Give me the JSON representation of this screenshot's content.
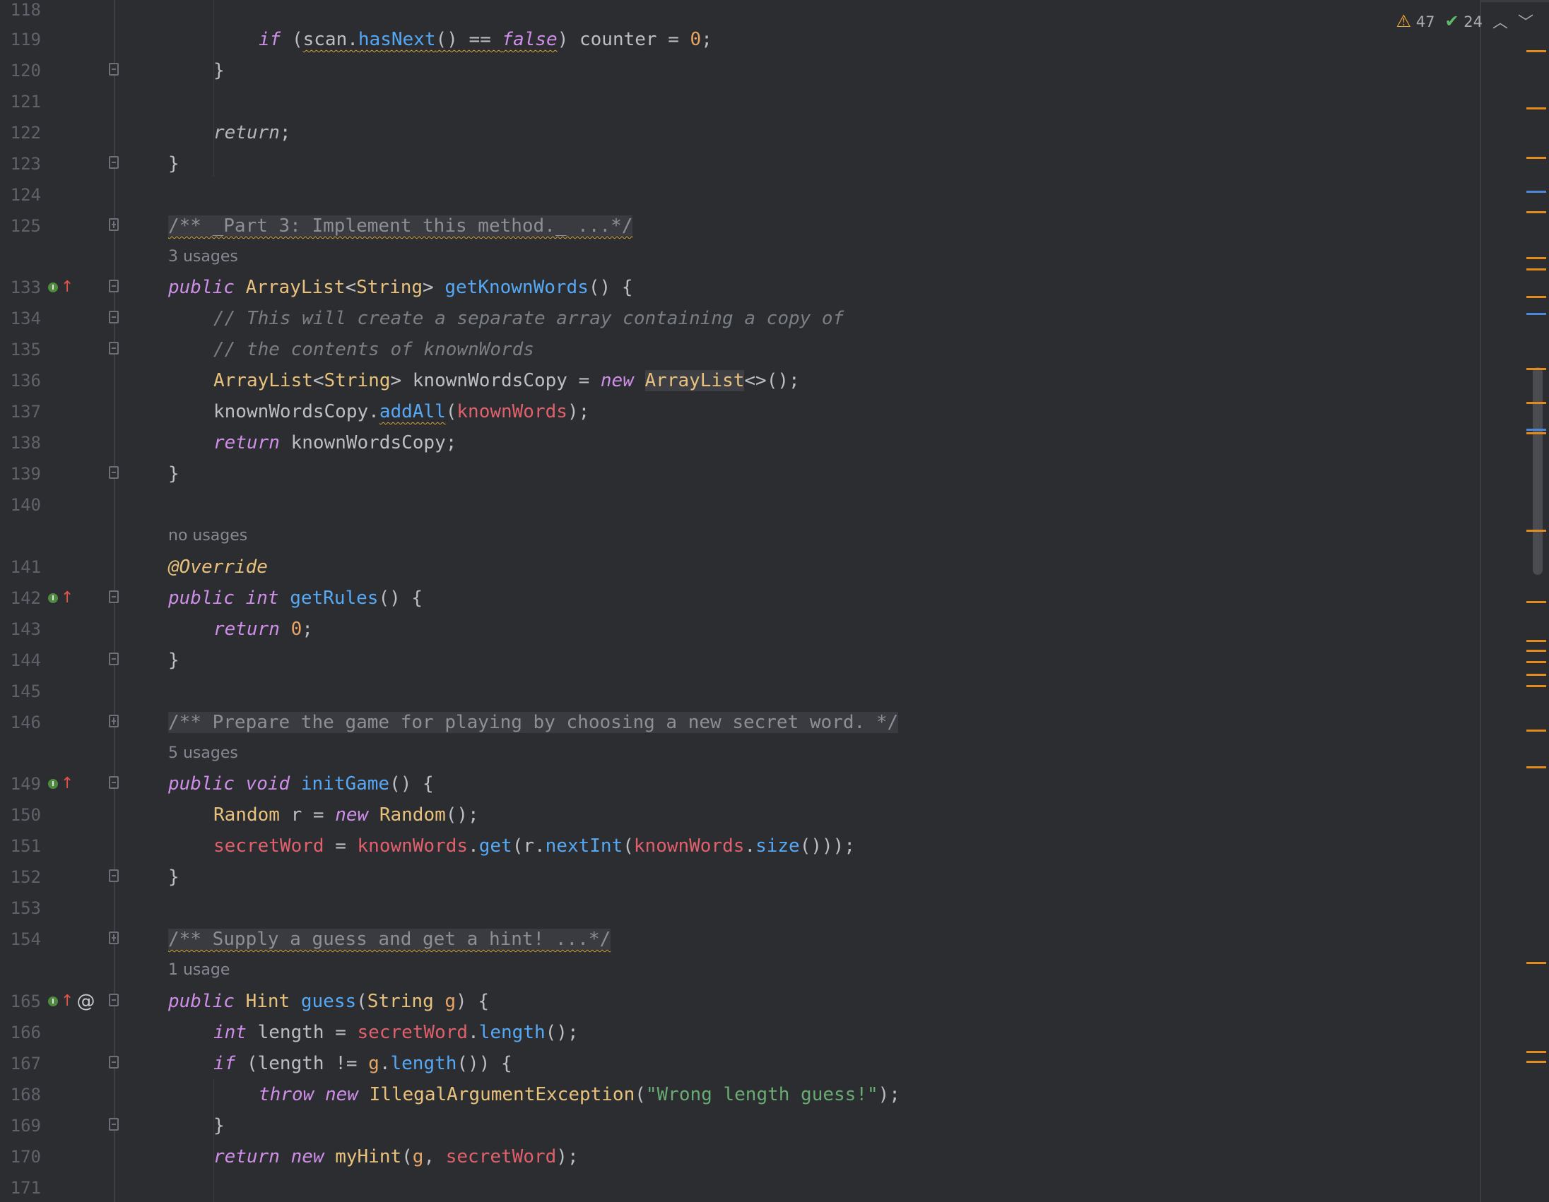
{
  "inspections": {
    "warnings": "47",
    "weak_warnings": "24"
  },
  "gutter_lines": [
    {
      "n": "118"
    },
    {
      "n": "119"
    },
    {
      "n": "120"
    },
    {
      "n": "121"
    },
    {
      "n": "122"
    },
    {
      "n": "123"
    },
    {
      "n": "124"
    },
    {
      "n": "125"
    },
    {
      "n": "133"
    },
    {
      "n": "134"
    },
    {
      "n": "135"
    },
    {
      "n": "136"
    },
    {
      "n": "137"
    },
    {
      "n": "138"
    },
    {
      "n": "139"
    },
    {
      "n": "140"
    },
    {
      "n": "141"
    },
    {
      "n": "142"
    },
    {
      "n": "143"
    },
    {
      "n": "144"
    },
    {
      "n": "145"
    },
    {
      "n": "146"
    },
    {
      "n": "149"
    },
    {
      "n": "150"
    },
    {
      "n": "151"
    },
    {
      "n": "152"
    },
    {
      "n": "153"
    },
    {
      "n": "154"
    },
    {
      "n": "165"
    },
    {
      "n": "166"
    },
    {
      "n": "167"
    },
    {
      "n": "168"
    },
    {
      "n": "169"
    },
    {
      "n": "170"
    },
    {
      "n": "171"
    }
  ],
  "code": {
    "l119": {
      "kw_if": "if",
      "open": " (",
      "scan": "scan.",
      "hasNext": "hasNext",
      "call": "() == ",
      "false": "false",
      "rest": ") counter = ",
      "zero": "0",
      "end": ";"
    },
    "l120": "}",
    "l122": {
      "ret": "return",
      "semi": ";"
    },
    "l123": "}",
    "l125": "/** _Part 3: Implement this method._ ...*/",
    "u125": "3 usages",
    "l133": {
      "public": "public",
      "type": "ArrayList",
      "lt": "<",
      "string": "String",
      "gt": "> ",
      "fn": "getKnownWords",
      "rest": "() {"
    },
    "l134": "// This will create a separate array containing a copy of",
    "l135": "// the contents of knownWords",
    "l136": {
      "type": "ArrayList",
      "lt": "<",
      "string": "String",
      "mid": "> knownWordsCopy = ",
      "new": "new",
      "type2": "ArrayList",
      "rest": "<>();"
    },
    "l137": {
      "obj": "knownWordsCopy.",
      "fn": "addAll",
      "open": "(",
      "field": "knownWords",
      "rest": ");"
    },
    "l138": {
      "ret": "return",
      "rest": " knownWordsCopy;"
    },
    "l139": "}",
    "u141": "no usages",
    "l141": "@Override",
    "l142": {
      "public": "public",
      "int": "int",
      "fn": "getRules",
      "rest": "() {"
    },
    "l143": {
      "ret": "return",
      "zero": "0",
      "semi": ";"
    },
    "l144": "}",
    "l146": "/** Prepare the game for playing by choosing a new secret word. */",
    "u146": "5 usages",
    "l149": {
      "public": "public",
      "void": "void",
      "fn": "initGame",
      "rest": "() {"
    },
    "l150": {
      "type": "Random",
      "mid": " r = ",
      "new": "new",
      "type2": "Random",
      "rest": "();"
    },
    "l151": {
      "field": "secretWord",
      "eq": " = ",
      "field2": "knownWords",
      "dot": ".",
      "get": "get",
      "open": "(r.",
      "nextInt": "nextInt",
      "open2": "(",
      "field3": "knownWords",
      "dot2": ".",
      "size": "size",
      "rest": "()));"
    },
    "l152": "}",
    "l154": "/** Supply a guess and get a hint! ...*/",
    "u154": "1 usage",
    "l165": {
      "public": "public",
      "type": "Hint",
      "fn": "guess",
      "open": "(",
      "string": "String",
      "param": "g",
      "rest": ") {"
    },
    "l166": {
      "int": "int",
      "mid": " length = ",
      "field": "secretWord",
      "dot": ".",
      "fn": "length",
      "rest": "();"
    },
    "l167": {
      "if": "if",
      "mid": " (length != ",
      "g": "g",
      "dot": ".",
      "fn": "length",
      "rest": "()) {"
    },
    "l168": {
      "throw": "throw",
      "new": "new",
      "type": "IllegalArgumentException",
      "open": "(",
      "str": "\"Wrong length guess!\"",
      "rest": ");"
    },
    "l169": "}",
    "l170": {
      "ret": "return",
      "new": "new",
      "fn": "myHint",
      "open": "(",
      "g": "g",
      "comma": ", ",
      "field": "secretWord",
      "rest": ");"
    }
  }
}
